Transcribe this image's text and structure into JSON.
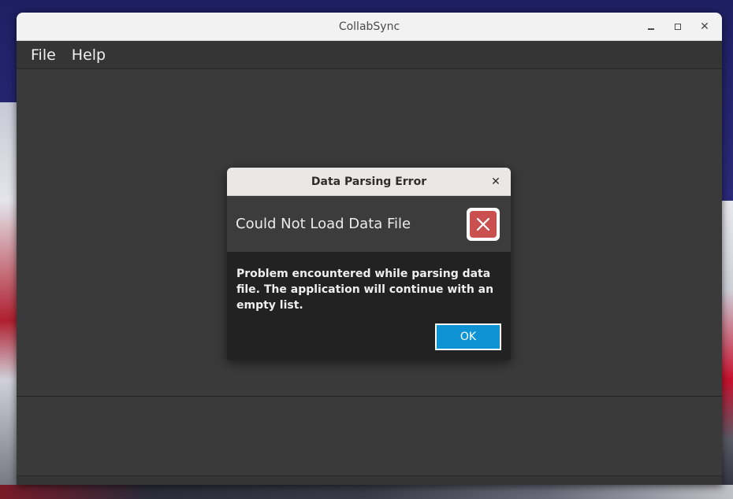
{
  "window": {
    "title": "CollabSync",
    "controls": {
      "minimize_icon": "minimize-icon",
      "maximize_icon": "maximize-icon",
      "close_icon": "close-icon",
      "close_glyph": "✕"
    }
  },
  "menubar": {
    "items": [
      {
        "label": "File"
      },
      {
        "label": "Help"
      }
    ]
  },
  "dialog": {
    "title": "Data Parsing Error",
    "close_glyph": "✕",
    "header": "Could Not Load Data File",
    "icon": "error-icon",
    "message": "Problem encountered while parsing data file. The application will continue with an empty list.",
    "ok_label": "OK"
  },
  "colors": {
    "accent": "#0f93d4",
    "error": "#c9504e",
    "window_bg": "#3a3a3a",
    "dialog_bg": "#222222"
  }
}
